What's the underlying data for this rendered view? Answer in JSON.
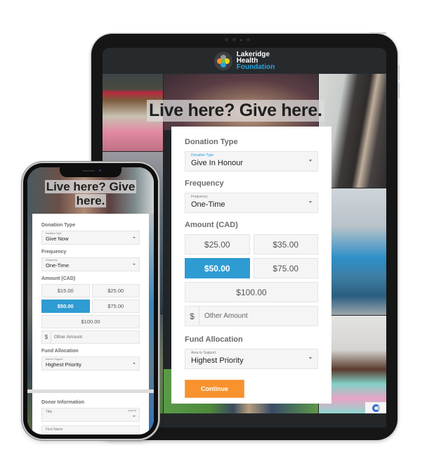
{
  "brand": {
    "line1": "Lakeridge",
    "line2": "Health",
    "line3": "Foundation",
    "accent_color": "#27a3dc",
    "logo_colors": [
      "#9a9a9a",
      "#f7922e",
      "#f3d31a",
      "#27a3dc",
      "#6fbe44"
    ]
  },
  "tablet": {
    "hero_title": "Live here? Give here.",
    "form": {
      "donation_type": {
        "section_label": "Donation Type",
        "field_label": "Donation Type",
        "value": "Give In Honour"
      },
      "frequency": {
        "section_label": "Frequency",
        "field_label": "Frequency",
        "value": "One-Time"
      },
      "amount": {
        "section_label": "Amount (CAD)",
        "options": [
          "$25.00",
          "$35.00",
          "$50.00",
          "$75.00",
          "$100.00"
        ],
        "selected": "$50.00",
        "currency_symbol": "$",
        "other_placeholder": "Other Amount"
      },
      "fund": {
        "section_label": "Fund Allocation",
        "field_label": "Area to Support",
        "value": "Highest Priority"
      },
      "continue_label": "Continue",
      "continue_color": "#f7922e",
      "selected_color": "#2f9bd3"
    }
  },
  "phone": {
    "hero_line1": "Live here? Give",
    "hero_line2": "here.",
    "form": {
      "donation_type": {
        "section_label": "Donation Type",
        "field_label": "Donation Type",
        "value": "Give Now"
      },
      "frequency": {
        "section_label": "Frequency",
        "field_label": "Frequency",
        "value": "One-Time"
      },
      "amount": {
        "section_label": "Amount (CAD)",
        "options": [
          "$15.00",
          "$25.00",
          "$50.00",
          "$75.00",
          "$100.00"
        ],
        "selected": "$50.00",
        "currency_symbol": "$",
        "other_placeholder": "Other Amount"
      },
      "fund": {
        "section_label": "Fund Allocation",
        "field_label": "Area to Support",
        "value": "Highest Priority"
      }
    },
    "donor": {
      "section_label": "Donor Information",
      "title_placeholder": "Title",
      "title_optional": "optional",
      "first_name_placeholder": "First Name"
    }
  }
}
